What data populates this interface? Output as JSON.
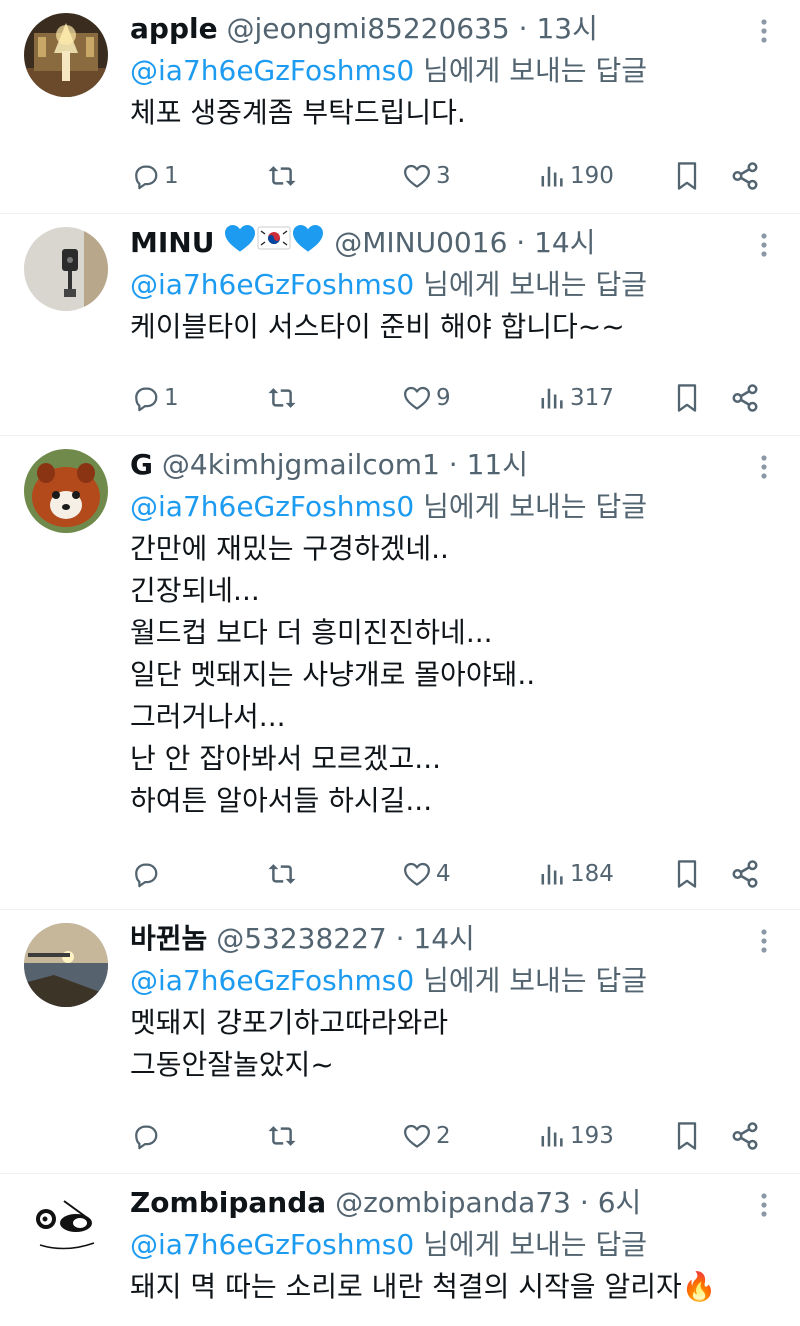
{
  "tweets": [
    {
      "name": "apple",
      "handle": "@jeongmi85220635",
      "time": "13시",
      "reply_to_handle": "@ia7h6eGzFoshms0",
      "reply_to_suffix": "님에게 보내는 답글",
      "text_lines": [
        "체포 생중계좀 부탁드립니다."
      ],
      "replies": "1",
      "retweets": "",
      "likes": "3",
      "views": "190"
    },
    {
      "name": "MINU",
      "name_emoji": [
        "blue-heart",
        "south-korea-flag",
        "blue-heart"
      ],
      "handle": "@MINU0016",
      "time": "14시",
      "reply_to_handle": "@ia7h6eGzFoshms0",
      "reply_to_suffix": "님에게 보내는 답글",
      "text_lines": [
        "케이블타이 서스타이 준비 해야 합니다~~"
      ],
      "replies": "1",
      "retweets": "",
      "likes": "9",
      "views": "317"
    },
    {
      "name": "G",
      "handle": "@4kimhjgmailcom1",
      "time": "11시",
      "reply_to_handle": "@ia7h6eGzFoshms0",
      "reply_to_suffix": "님에게 보내는 답글",
      "text_lines": [
        "간만에 재밌는 구경하겠네..",
        "긴장되네...",
        "월드컵 보다 더 흥미진진하네...",
        "일단 멧돼지는 사냥개로 몰아야돼..",
        "그러거나서...",
        "난 안 잡아봐서 모르겠고...",
        "하여튼 알아서들 하시길..."
      ],
      "replies": "",
      "retweets": "",
      "likes": "4",
      "views": "184"
    },
    {
      "name": "바뀐놈",
      "handle": "@53238227",
      "time": "14시",
      "reply_to_handle": "@ia7h6eGzFoshms0",
      "reply_to_suffix": "님에게 보내는 답글",
      "text_lines": [
        "멧돼지 걍포기하고따라와라",
        "그동안잘놀았지~"
      ],
      "replies": "",
      "retweets": "",
      "likes": "2",
      "views": "193"
    },
    {
      "name": "Zombipanda",
      "handle": "@zombipanda73",
      "time": "6시",
      "reply_to_handle": "@ia7h6eGzFoshms0",
      "reply_to_suffix": "님에게 보내는 답글",
      "text_lines": [
        "돼지 멱 따는 소리로 내란 척결의 시작을 알리자🔥"
      ]
    }
  ],
  "separator": "·",
  "colors": {
    "text": "#0f1419",
    "secondary": "#536471",
    "link": "#1d9bf0",
    "divider": "#eff3f4",
    "heart_emoji": "#1d9bf0"
  },
  "icons": [
    "reply-icon",
    "retweet-icon",
    "like-icon",
    "views-icon",
    "bookmark-icon",
    "share-icon",
    "more-icon"
  ]
}
